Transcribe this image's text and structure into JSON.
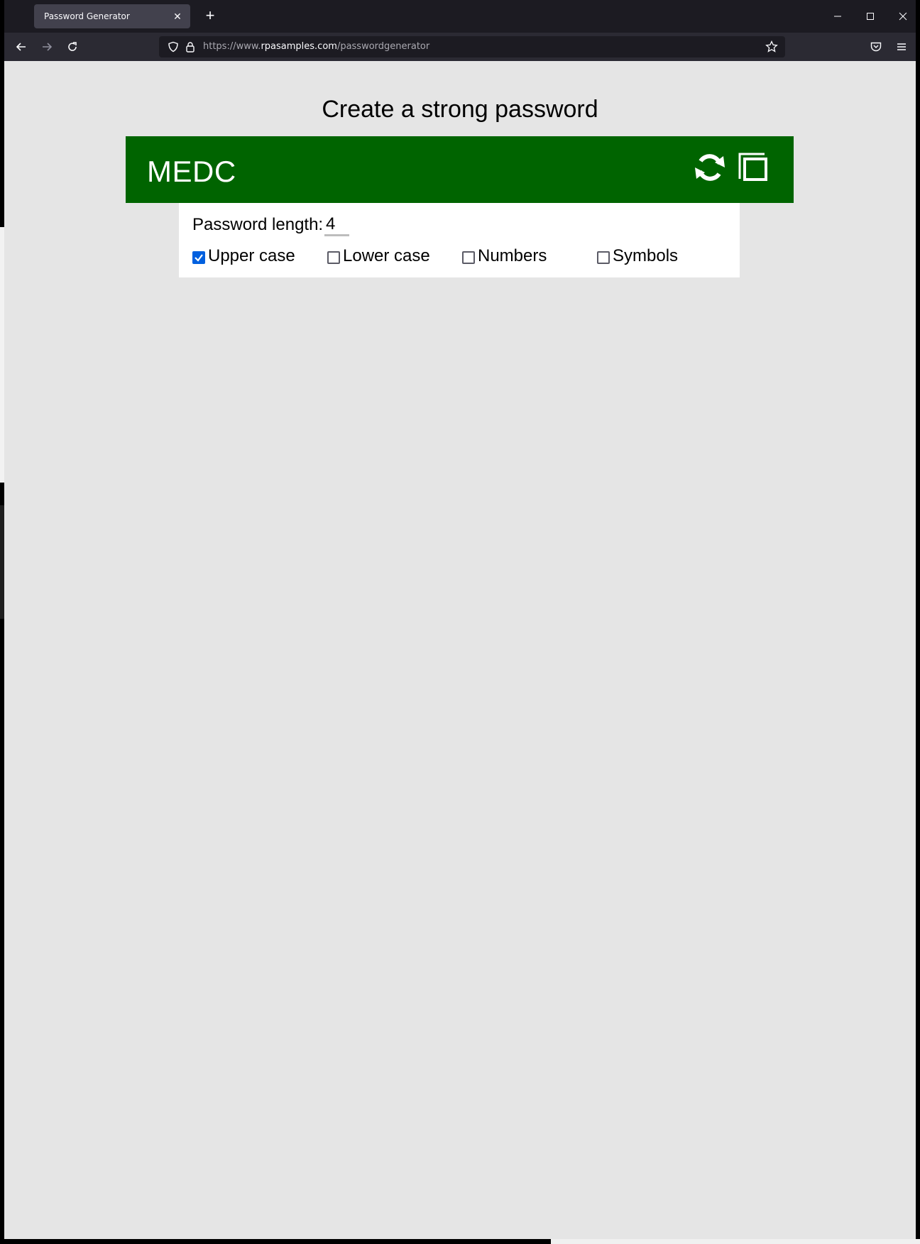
{
  "browser": {
    "tab_title": "Password Generator",
    "tab_close": "✕",
    "new_tab": "+",
    "url_prefix": "https://www.",
    "url_domain": "rpasamples.com",
    "url_path": "/passwordgenerator"
  },
  "page": {
    "title": "Create a strong password",
    "password": "MEDC",
    "length_label": "Password length:",
    "length_value": "4",
    "options": [
      {
        "label": "Upper case",
        "checked": true
      },
      {
        "label": "Lower case",
        "checked": false
      },
      {
        "label": "Numbers",
        "checked": false
      },
      {
        "label": "Symbols",
        "checked": false
      }
    ]
  },
  "colors": {
    "password_bar": "#006400",
    "checkbox_checked": "#0060df"
  }
}
